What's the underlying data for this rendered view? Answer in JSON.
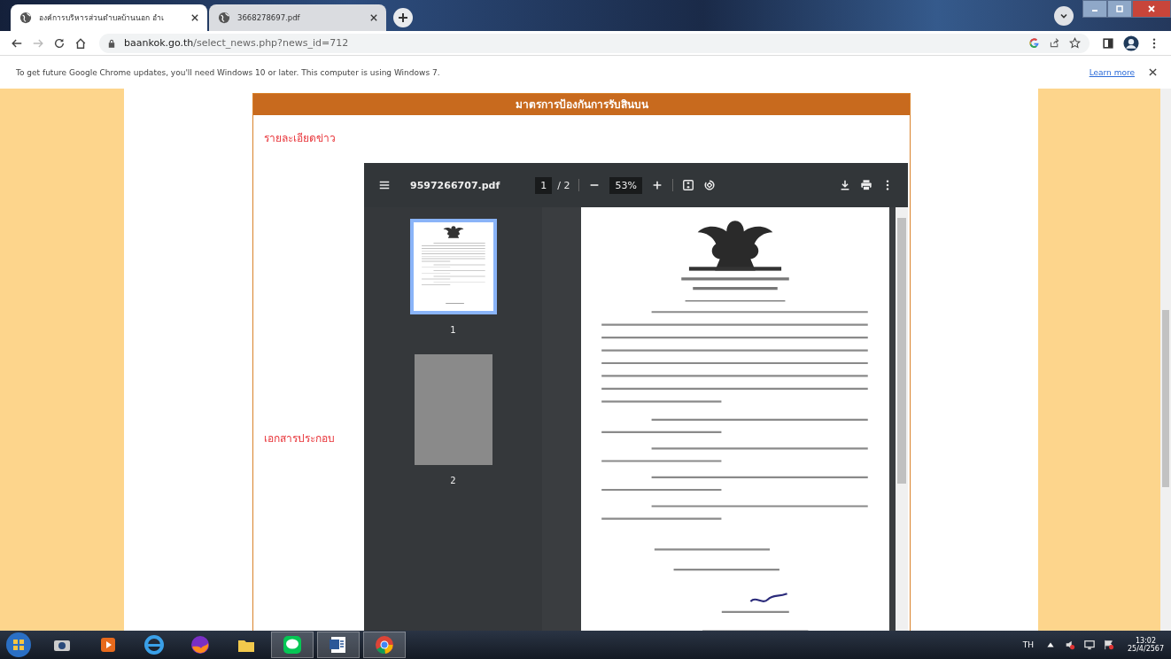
{
  "browser": {
    "tabs": [
      {
        "title": "องค์การบริหารส่วนตำบลบ้านนอก อำเ",
        "selected": true
      },
      {
        "title": "3668278697.pdf",
        "selected": false
      }
    ],
    "address": {
      "domain": "baankok.go.th",
      "path": "/select_news.php?news_id=712"
    }
  },
  "info_bar": {
    "message": "To get future Google Chrome updates, you'll need Windows 10 or later. This computer is using Windows 7.",
    "link": "Learn more"
  },
  "article": {
    "title": "มาตรการป้องกันการรับสินบน",
    "sections": [
      "รายละเอียดข่าว",
      "เอกสารประกอบ"
    ]
  },
  "pdf_viewer": {
    "file_name": "9597266707.pdf",
    "page_input": "1",
    "page_total": "/ 2",
    "zoom": "53%",
    "thumbnails": [
      {
        "label": "1",
        "selected": true
      },
      {
        "label": "2",
        "selected": false
      }
    ]
  },
  "taskbar": {
    "language": "TH",
    "time": "13:02",
    "date": "25/4/2567"
  }
}
